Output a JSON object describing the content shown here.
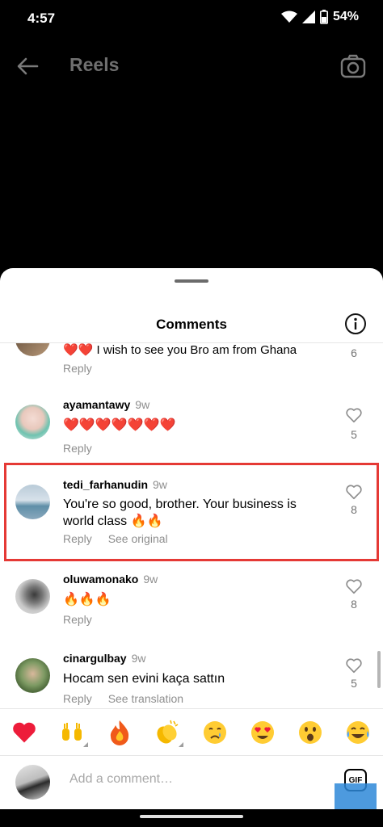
{
  "status_bar": {
    "time": "4:57",
    "battery": "54%"
  },
  "header": {
    "title": "Reels"
  },
  "sheet": {
    "title": "Comments"
  },
  "comments": [
    {
      "user": "",
      "time": "",
      "text": "❤️❤️ I wish to see you Bro am from Ghana",
      "reply": "Reply",
      "likes": "6"
    },
    {
      "user": "ayamantawy",
      "time": "9w",
      "text": "❤️❤️❤️❤️❤️❤️❤️",
      "reply": "Reply",
      "likes": "5"
    },
    {
      "user": "tedi_farhanudin",
      "time": "9w",
      "text": "You're so good, brother. Your business is world class 🔥🔥",
      "reply": "Reply",
      "extra": "See original",
      "likes": "8"
    },
    {
      "user": "oluwamonako",
      "time": "9w",
      "text": "🔥🔥🔥",
      "reply": "Reply",
      "likes": "8"
    },
    {
      "user": "cinargulbay",
      "time": "9w",
      "text": "Hocam sen evini kaça sattın",
      "reply": "Reply",
      "extra": "See translation",
      "likes": "5"
    }
  ],
  "emoji_reactions": [
    "❤️",
    "🙌",
    "🔥",
    "👏",
    "😢",
    "😍",
    "😮",
    "😂"
  ],
  "add_comment": {
    "placeholder": "Add a comment…",
    "gif_label": "GIF"
  },
  "colors": {
    "highlight": "#e53935",
    "sheet_bg": "#ffffff",
    "muted": "#8e8e8e"
  }
}
